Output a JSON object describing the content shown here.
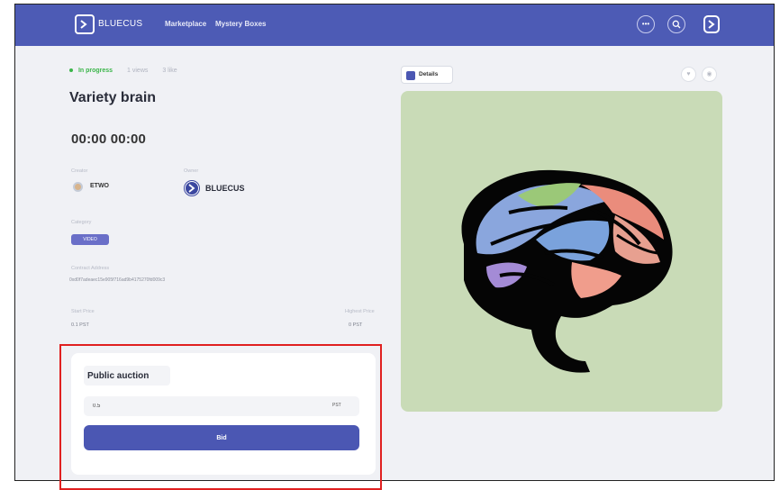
{
  "header": {
    "logo_text": "BLUECUS",
    "nav": [
      "Marketplace",
      "Mystery Boxes"
    ],
    "more_icon": "ellipsis-icon",
    "search_icon": "search-icon"
  },
  "item": {
    "status": "In progress",
    "meta_1": "1 views",
    "meta_2": "3 like",
    "title": "Variety brain",
    "timer": "00:00 00:00",
    "creator_label": "Creator",
    "creator_name": "ETWO",
    "owner_label": "Owner",
    "owner_name": "BLUECUS",
    "category_label": "Category",
    "category_value": "VIDEO",
    "contract_label": "Contract Address",
    "contract_value": "0xd0f7adeaec15e905f716ad9b4175270fd009c3",
    "start_price_label": "Start Price",
    "start_price": "0.1 PST",
    "highest_price_label": "Highest Price",
    "highest_price": "0 PST"
  },
  "auction": {
    "label": "Public auction",
    "bid_value": "0.5",
    "unit": "PST",
    "button": "Bid"
  },
  "preview": {
    "details_label": "Details",
    "like_icon": "heart-icon",
    "share_icon": "share-icon",
    "image_subject": "brain illustration",
    "bg_color": "#c9dbb7"
  },
  "colors": {
    "header": "#4d5bb5",
    "accent": "#4b57b3",
    "status_green": "#3bb54a",
    "highlight": "#e02020"
  }
}
